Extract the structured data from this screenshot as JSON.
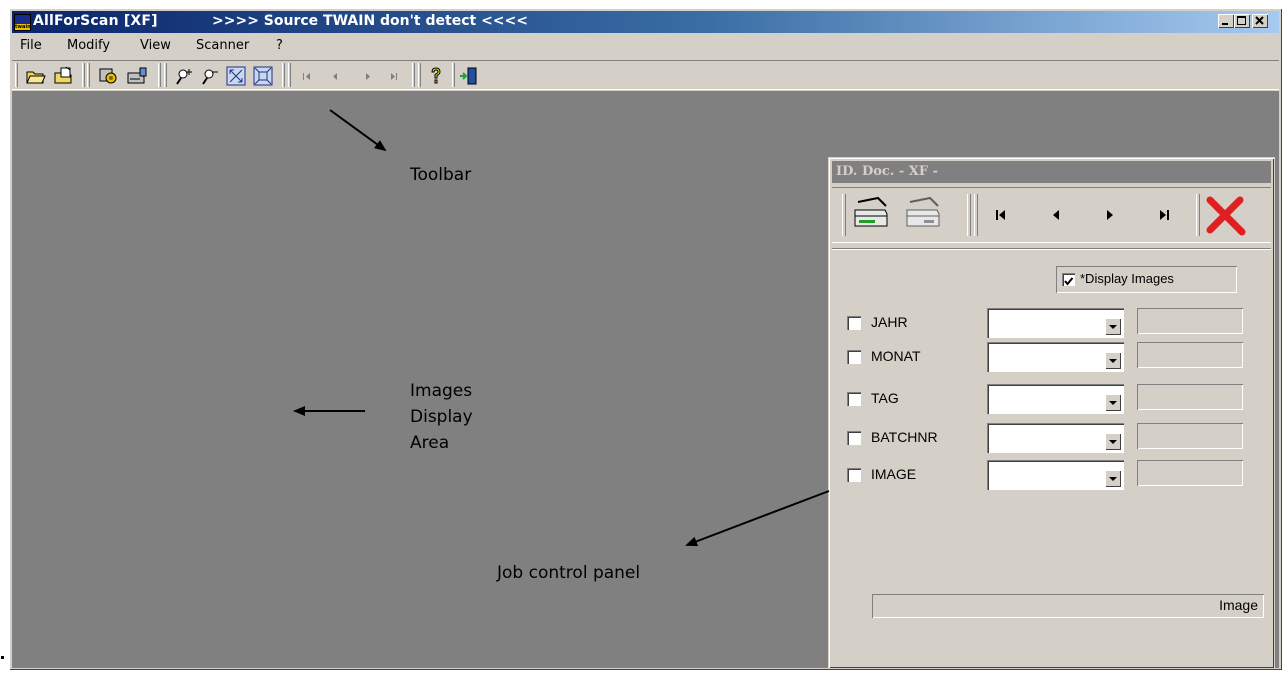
{
  "window": {
    "app_title": "AllForScan [XF]",
    "title_message": ">>>> Source TWAIN  don't detect <<<<",
    "icon_label": "twain"
  },
  "menu": [
    "File",
    "Modify",
    "View",
    "Scanner",
    "?"
  ],
  "toolbar": {
    "icons": [
      "open-folder-icon",
      "open-file-icon",
      "scan-settings-icon",
      "scanner-config-icon",
      "zoom-in-icon",
      "zoom-out-icon",
      "fit-window-icon",
      "actual-size-icon",
      "first-page-icon",
      "previous-page-icon",
      "next-page-icon",
      "last-page-icon",
      "help-icon",
      "exit-icon"
    ]
  },
  "annotations": {
    "toolbar": "Toolbar",
    "display_line1": "Images",
    "display_line2": "Display",
    "display_line3": "Area",
    "panel": "Job control panel"
  },
  "panel": {
    "title": "ID. Doc. - XF -",
    "display_images_label": "*Display Images",
    "display_images_checked": true,
    "fields": [
      {
        "label": "JAHR",
        "checked": false,
        "value": ""
      },
      {
        "label": "MONAT",
        "checked": false,
        "value": ""
      },
      {
        "label": "TAG",
        "checked": false,
        "value": ""
      },
      {
        "label": "BATCHNR",
        "checked": false,
        "value": ""
      },
      {
        "label": "IMAGE",
        "checked": false,
        "value": ""
      }
    ],
    "status_text": "Image"
  },
  "colors": {
    "title_gradient_start": "#0a246a",
    "title_gradient_end": "#a6caf0",
    "window_face": "#d4d0c8",
    "display_area": "#808080",
    "panel_title_inactive": "#808080",
    "close_x": "#e02020"
  }
}
